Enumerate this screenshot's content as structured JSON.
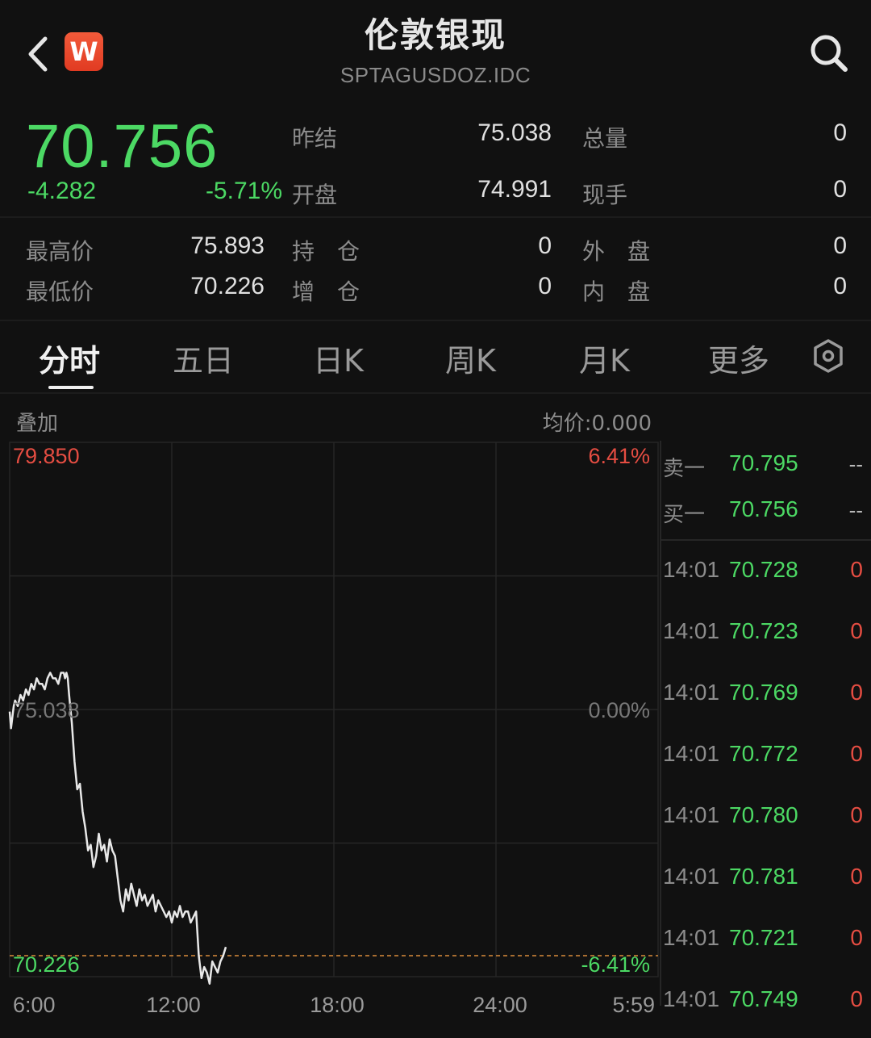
{
  "header": {
    "title": "伦敦银现",
    "subtitle": "SPTAGUSDOZ.IDC",
    "logo_letter": "W",
    "icons": {
      "back": "chevron-left-icon",
      "search": "search-icon",
      "settings": "hexagon-settings-icon"
    }
  },
  "quote": {
    "price": "70.756",
    "change": "-4.282",
    "change_pct": "-5.71%",
    "stats": [
      {
        "label": "昨结",
        "value": "75.038"
      },
      {
        "label": "开盘",
        "value": "74.991"
      },
      {
        "label": "总量",
        "value": "0"
      },
      {
        "label": "现手",
        "value": "0"
      },
      {
        "label": "最高价",
        "value": "75.893"
      },
      {
        "label": "最低价",
        "value": "70.226"
      },
      {
        "label": "持　仓",
        "value": "0"
      },
      {
        "label": "增　仓",
        "value": "0"
      },
      {
        "label": "外　盘",
        "value": "0"
      },
      {
        "label": "内　盘",
        "value": "0"
      }
    ]
  },
  "tabs": [
    {
      "label": "分时",
      "active": true
    },
    {
      "label": "五日",
      "active": false
    },
    {
      "label": "日K",
      "active": false
    },
    {
      "label": "周K",
      "active": false
    },
    {
      "label": "月K",
      "active": false
    },
    {
      "label": "更多",
      "active": false
    }
  ],
  "chart_labels": {
    "overlay": "叠加",
    "avg_price": "均价:0.000"
  },
  "chart_data": {
    "type": "line",
    "title": "",
    "ylim": [
      70.226,
      79.85
    ],
    "prev_close": 75.038,
    "y_tick_labels": {
      "top": "79.850",
      "mid": "75.038",
      "bottom": "70.226"
    },
    "pct_tick_labels": {
      "top": "6.41%",
      "mid": "0.00%",
      "bottom": "-6.41%"
    },
    "x_tick_labels": [
      "6:00",
      "12:00",
      "18:00",
      "24:00",
      "5:59"
    ],
    "x_range_hours": [
      0,
      24
    ],
    "reference_line_value": 70.226,
    "colors": {
      "up": "#e54d42",
      "down": "#4cd964",
      "line": "#e8e8e8",
      "ref": "#d98c3a"
    },
    "series": [
      {
        "x": [
          0.0,
          0.05,
          0.1,
          0.15,
          0.2,
          0.3,
          0.4,
          0.5,
          0.6,
          0.7,
          0.8,
          0.9,
          1.0,
          1.1,
          1.2,
          1.3,
          1.4,
          1.5,
          1.6,
          1.7,
          1.8,
          1.9,
          2.0,
          2.05,
          2.1,
          2.15,
          2.2,
          2.3,
          2.4,
          2.5,
          2.6,
          2.7,
          2.8,
          2.9,
          3.0,
          3.1,
          3.2,
          3.3,
          3.4,
          3.5,
          3.6,
          3.7,
          3.8,
          3.9,
          4.0,
          4.1,
          4.2,
          4.3,
          4.4,
          4.5,
          4.6,
          4.7,
          4.8,
          4.9,
          5.0,
          5.1,
          5.2,
          5.3,
          5.4,
          5.5,
          5.6,
          5.7,
          5.8,
          5.9,
          6.0,
          6.1,
          6.2,
          6.3,
          6.4,
          6.5,
          6.6,
          6.7,
          6.8,
          6.9,
          7.0,
          7.1,
          7.2,
          7.3,
          7.4,
          7.5,
          7.6,
          7.7,
          7.8,
          7.9,
          8.0
        ],
        "values": [
          75.0,
          74.7,
          74.9,
          75.1,
          75.2,
          75.1,
          75.3,
          75.2,
          75.4,
          75.3,
          75.5,
          75.4,
          75.6,
          75.5,
          75.5,
          75.4,
          75.6,
          75.7,
          75.6,
          75.6,
          75.5,
          75.7,
          75.7,
          75.6,
          75.7,
          75.6,
          75.3,
          74.8,
          74.1,
          73.6,
          73.7,
          73.2,
          72.9,
          72.5,
          72.6,
          72.2,
          72.4,
          72.8,
          72.5,
          72.6,
          72.3,
          72.7,
          72.5,
          72.4,
          72.0,
          71.6,
          71.4,
          71.8,
          71.6,
          71.9,
          71.7,
          71.5,
          71.8,
          71.6,
          71.7,
          71.5,
          71.6,
          71.7,
          71.4,
          71.6,
          71.5,
          71.4,
          71.3,
          71.4,
          71.2,
          71.4,
          71.3,
          71.5,
          71.3,
          71.4,
          71.4,
          71.2,
          71.3,
          71.4,
          70.6,
          70.2,
          70.4,
          70.3,
          70.1,
          70.5,
          70.4,
          70.3,
          70.5,
          70.6,
          70.76
        ]
      }
    ]
  },
  "order_book": [
    {
      "label": "卖一",
      "price": "70.795",
      "volume": "--"
    },
    {
      "label": "买一",
      "price": "70.756",
      "volume": "--"
    }
  ],
  "trades": [
    {
      "time": "14:01",
      "price": "70.728",
      "volume": "0"
    },
    {
      "time": "14:01",
      "price": "70.723",
      "volume": "0"
    },
    {
      "time": "14:01",
      "price": "70.769",
      "volume": "0"
    },
    {
      "time": "14:01",
      "price": "70.772",
      "volume": "0"
    },
    {
      "time": "14:01",
      "price": "70.780",
      "volume": "0"
    },
    {
      "time": "14:01",
      "price": "70.781",
      "volume": "0"
    },
    {
      "time": "14:01",
      "price": "70.721",
      "volume": "0"
    },
    {
      "time": "14:01",
      "price": "70.749",
      "volume": "0"
    }
  ]
}
